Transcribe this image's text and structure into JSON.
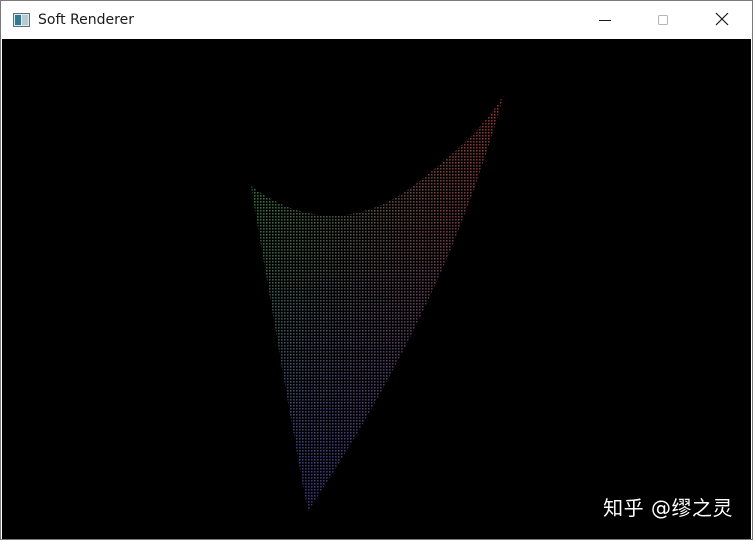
{
  "window": {
    "title": "Soft Renderer",
    "app_icon": "window-app-icon",
    "controls": {
      "minimize_icon": "minimize-icon",
      "maximize_icon": "maximize-icon",
      "close_icon": "close-icon"
    }
  },
  "viewport": {
    "background": "#000000",
    "watermark": "知乎 @缪之灵",
    "surface": {
      "rendering": "point-sampled wireframe surface",
      "colors": {
        "top_left": "#3a9a2a",
        "top_right": "#b0342c",
        "bottom": "#3a2a8a"
      }
    }
  }
}
